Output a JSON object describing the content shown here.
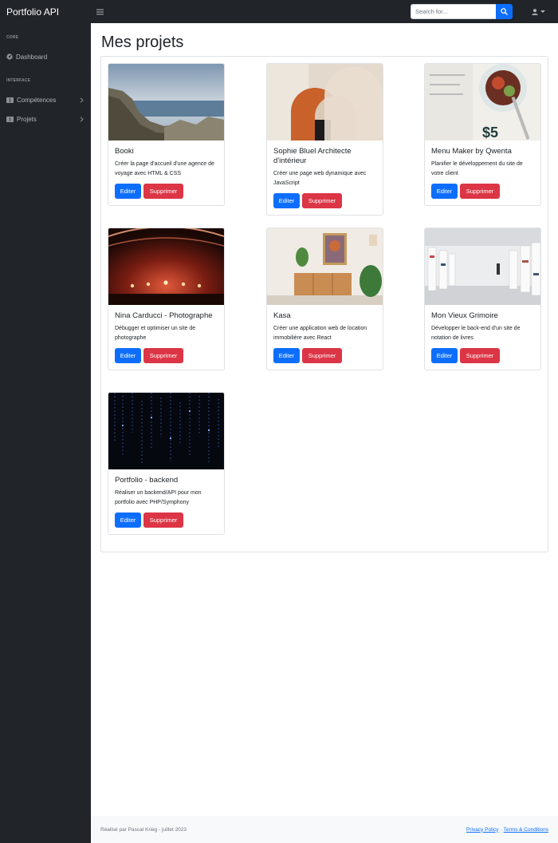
{
  "topbar": {
    "brand": "Portfolio API",
    "search_placeholder": "Search for..."
  },
  "sidebar": {
    "section_core": "CORE",
    "dashboard_label": "Dashboard",
    "section_interface": "INTERFACE",
    "competences_label": "Compétences",
    "projets_label": "Projets"
  },
  "main": {
    "title": "Mes projets"
  },
  "projects": [
    {
      "title": "Booki",
      "description": "Créer la page d'accueil d'une agence de voyage avec HTML & CSS",
      "edit_label": "Editer",
      "delete_label": "Supprimer"
    },
    {
      "title": "Sophie Bluel Architecte d'intérieur",
      "description": "Créer une page web dynamique avec JavaScript",
      "edit_label": "Editer",
      "delete_label": "Supprimer"
    },
    {
      "title": "Menu Maker by Qwenta",
      "description": "Planifier le développement du site de votre client",
      "edit_label": "Editer",
      "delete_label": "Supprimer"
    },
    {
      "title": "Nina Carducci - Photographe",
      "description": "Débugger et optimiser un site de photographe",
      "edit_label": "Editer",
      "delete_label": "Supprimer"
    },
    {
      "title": "Kasa",
      "description": "Créer une application web de location immobilière avec React",
      "edit_label": "Editer",
      "delete_label": "Supprimer"
    },
    {
      "title": "Mon Vieux Grimoire",
      "description": "Développer le back-end d'un site de notation de livres",
      "edit_label": "Editer",
      "delete_label": "Supprimer"
    },
    {
      "title": "Portfolio - backend",
      "description": "Réaliser un backend/API pour mon portfolio avec PHP/Symphony",
      "edit_label": "Editer",
      "delete_label": "Supprimer"
    }
  ],
  "footer": {
    "credit": "Réalisé par Pascal Krieg - juillet 2023",
    "privacy": "Privacy Policy",
    "separator": "·",
    "terms": "Terms & Conditions"
  },
  "colors": {
    "primary": "#0d6efd",
    "danger": "#dc3545",
    "sidebar_bg": "#212529"
  }
}
